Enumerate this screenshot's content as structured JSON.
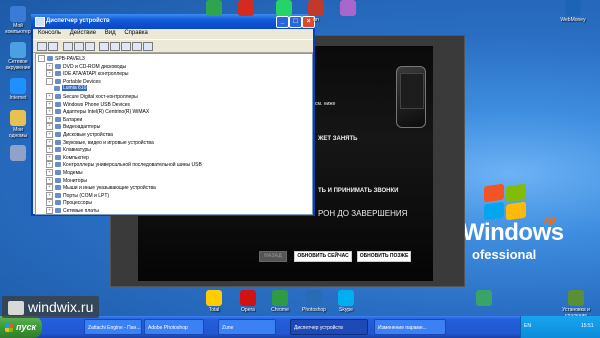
{
  "desktop_icons": [
    {
      "label": "Мой компьютер",
      "icon": "computer-icon",
      "color": "#3a7bd5"
    },
    {
      "label": "Сетевое окружение",
      "icon": "network-icon",
      "color": "#4aa0e0"
    },
    {
      "label": "Internet",
      "icon": "internet-explorer-icon",
      "color": "#1e90ff"
    },
    {
      "label": "Мои\nодномы",
      "icon": "folder-icon",
      "color": "#e7c152"
    },
    {
      "label": "",
      "icon": "recycle-bin-icon",
      "color": "#8fa3c9"
    }
  ],
  "top_icons": [
    {
      "label": "",
      "icon": "app-green-icon",
      "color": "#2ea44f"
    },
    {
      "label": "",
      "icon": "app-red-k-icon",
      "color": "#d52b1e"
    },
    {
      "label": "",
      "icon": "whatsapp-icon",
      "color": "#25d366"
    },
    {
      "label": "on",
      "icon": "app-icon",
      "color": "#c0392b"
    },
    {
      "label": "",
      "icon": "app-icon",
      "color": "#aa66cc"
    },
    {
      "label": "WebMoney",
      "icon": "webmoney-icon",
      "color": "#1c65b6"
    }
  ],
  "bottom_icons": [
    {
      "label": "Total",
      "icon": "total-commander-icon",
      "color": "#ffcc00"
    },
    {
      "label": "Opera",
      "icon": "opera-icon",
      "color": "#d31111"
    },
    {
      "label": "Chrome",
      "icon": "chrome-icon",
      "color": "#2e9b44"
    },
    {
      "label": "Photoshop",
      "icon": "photoshop-icon",
      "color": "#2a6bb5"
    },
    {
      "label": "Skype",
      "icon": "skype-icon",
      "color": "#00aff0"
    },
    {
      "label": "",
      "icon": "app-icon",
      "color": "#3aa36a"
    },
    {
      "label": "Установка и удаление",
      "icon": "install-icon",
      "color": "#5a8f3a"
    }
  ],
  "xp_logo": {
    "word": "Windows",
    "sup": "xp",
    "edition": "ofessional"
  },
  "media": {
    "line1": "см. ниже",
    "line2": "ЖЕТ ЗАНЯТЬ",
    "line3": "ТЬ И ПРИНИМАТЬ ЗВОНКИ",
    "line4": "РОН ДО ЗАВЕРШЕНИЯ",
    "btn_back": "НАЗАД",
    "btn_update_now": "ОБНОВИТЬ СЕЙЧАС",
    "btn_update_later": "ОБНОВИТЬ ПОЗЖЕ"
  },
  "dm": {
    "title": "Диспетчер устройств",
    "menu": [
      "Консоль",
      "Действие",
      "Вид",
      "Справка"
    ],
    "tree": [
      {
        "indent": 0,
        "label": "SPB-PAVEL3",
        "expand": "-"
      },
      {
        "indent": 1,
        "label": "DVD и CD-ROM дисководы",
        "expand": "+"
      },
      {
        "indent": 1,
        "label": "IDE ATA/ATAPI контроллеры",
        "expand": "+"
      },
      {
        "indent": 1,
        "label": "Portable Devices",
        "expand": "-"
      },
      {
        "indent": 2,
        "label": "Lumia 610",
        "expand": "",
        "selected": true
      },
      {
        "indent": 1,
        "label": "Secure Digital хост-контроллеры",
        "expand": "+"
      },
      {
        "indent": 1,
        "label": "Windows Phone USB Devices",
        "expand": "+"
      },
      {
        "indent": 1,
        "label": "Адаптеры Intel(R) Centrino(R) WiMAX",
        "expand": "+"
      },
      {
        "indent": 1,
        "label": "Батареи",
        "expand": "+"
      },
      {
        "indent": 1,
        "label": "Видеоадаптеры",
        "expand": "+"
      },
      {
        "indent": 1,
        "label": "Дисковые устройства",
        "expand": "+"
      },
      {
        "indent": 1,
        "label": "Звуковые, видео и игровые устройства",
        "expand": "+"
      },
      {
        "indent": 1,
        "label": "Клавиатуры",
        "expand": "+"
      },
      {
        "indent": 1,
        "label": "Компьютер",
        "expand": "+"
      },
      {
        "indent": 1,
        "label": "Контроллеры универсальной последовательной шины USB",
        "expand": "+"
      },
      {
        "indent": 1,
        "label": "Модемы",
        "expand": "+"
      },
      {
        "indent": 1,
        "label": "Мониторы",
        "expand": "+"
      },
      {
        "indent": 1,
        "label": "Мыши и иные указывающие устройства",
        "expand": "+"
      },
      {
        "indent": 1,
        "label": "Порты (COM и LPT)",
        "expand": "+"
      },
      {
        "indent": 1,
        "label": "Процессоры",
        "expand": "+"
      },
      {
        "indent": 1,
        "label": "Сетевые платы",
        "expand": "+"
      }
    ]
  },
  "taskbar": {
    "start_label": "пуск",
    "tasks": [
      {
        "label": "Zattachi Engine - Пан..."
      },
      {
        "label": "Adobe Photoshop"
      },
      {
        "label": "Zune"
      },
      {
        "label": "Диспетчер устройств",
        "active": true
      },
      {
        "label": "Изменение параме..."
      }
    ],
    "lang": "EN",
    "clock": "15:51"
  },
  "watermark": "windwix.ru"
}
